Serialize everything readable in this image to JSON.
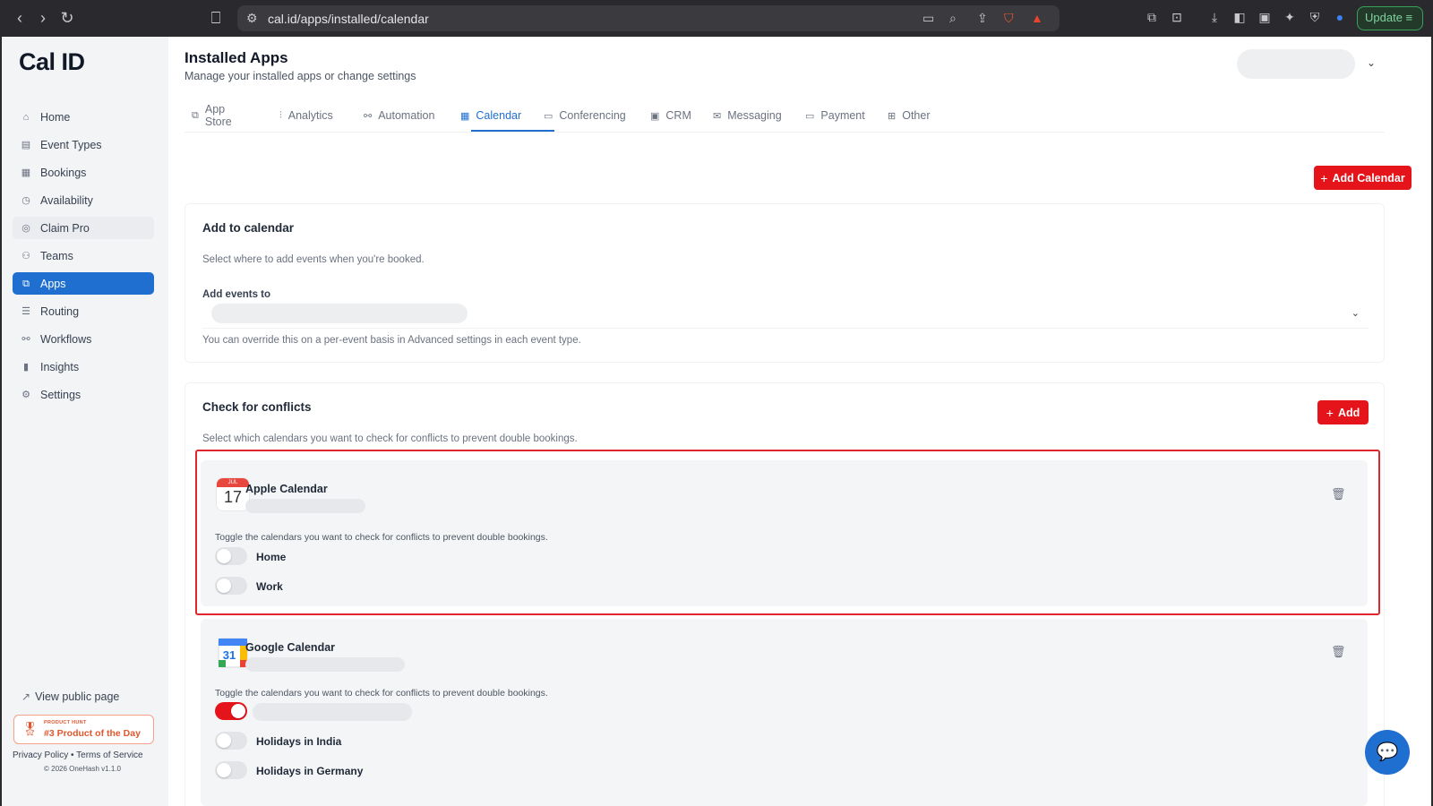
{
  "browser": {
    "url": "cal.id/apps/installed/calendar",
    "update_label": "Update"
  },
  "sidebar": {
    "logo": "Cal ID",
    "items": [
      {
        "label": "Home",
        "icon": "home-icon"
      },
      {
        "label": "Event Types",
        "icon": "event-types-icon"
      },
      {
        "label": "Bookings",
        "icon": "bookings-icon"
      },
      {
        "label": "Availability",
        "icon": "clock-icon"
      },
      {
        "label": "Claim Pro",
        "icon": "badge-icon"
      },
      {
        "label": "Teams",
        "icon": "users-icon"
      },
      {
        "label": "Apps",
        "icon": "apps-icon"
      },
      {
        "label": "Routing",
        "icon": "routing-icon"
      },
      {
        "label": "Workflows",
        "icon": "workflows-icon"
      },
      {
        "label": "Insights",
        "icon": "bar-chart-icon"
      },
      {
        "label": "Settings",
        "icon": "gear-icon"
      }
    ],
    "active": "Apps",
    "view_public": "View public page",
    "badge_small": "PRODUCT HUNT",
    "badge_big": "#3 Product of the Day",
    "privacy": "Privacy Policy",
    "separator": "•",
    "terms": "Terms of Service",
    "copyright": "© 2026 OneHash v1.1.0"
  },
  "header": {
    "title": "Installed Apps",
    "subtitle": "Manage your installed apps or change settings"
  },
  "tabs": [
    {
      "label": "App Store",
      "icon": "app-store-icon"
    },
    {
      "label": "Analytics",
      "icon": "analytics-icon"
    },
    {
      "label": "Automation",
      "icon": "automation-icon"
    },
    {
      "label": "Calendar",
      "icon": "calendar-icon"
    },
    {
      "label": "Conferencing",
      "icon": "video-icon"
    },
    {
      "label": "CRM",
      "icon": "crm-icon"
    },
    {
      "label": "Messaging",
      "icon": "mail-icon"
    },
    {
      "label": "Payment",
      "icon": "card-icon"
    },
    {
      "label": "Other",
      "icon": "grid-icon"
    }
  ],
  "active_tab": "Calendar",
  "add_calendar_label": "Add Calendar",
  "add_to_calendar": {
    "title": "Add to calendar",
    "description": "Select where to add events when you're booked.",
    "field_label": "Add events to",
    "note": "You can override this on a per-event basis in Advanced settings in each event type."
  },
  "conflicts": {
    "title": "Check for conflicts",
    "description": "Select which calendars you want to check for conflicts to prevent double bookings.",
    "add_label": "Add",
    "calendars": [
      {
        "name": "Apple Calendar",
        "icon_month": "JUL",
        "icon_day": "17",
        "hint": "Toggle the calendars you want to check for conflicts to prevent double bookings.",
        "toggles": [
          {
            "label": "Home",
            "on": false
          },
          {
            "label": "Work",
            "on": false
          }
        ]
      },
      {
        "name": "Google Calendar",
        "icon_day": "31",
        "hint": "Toggle the calendars you want to check for conflicts to prevent double bookings.",
        "toggles": [
          {
            "label": "",
            "on": true
          },
          {
            "label": "Holidays in India",
            "on": false
          },
          {
            "label": "Holidays in Germany",
            "on": false
          }
        ]
      }
    ]
  },
  "colors": {
    "accent": "#1f6fd1",
    "danger": "#e5141b",
    "highlight": "#e0262d"
  }
}
